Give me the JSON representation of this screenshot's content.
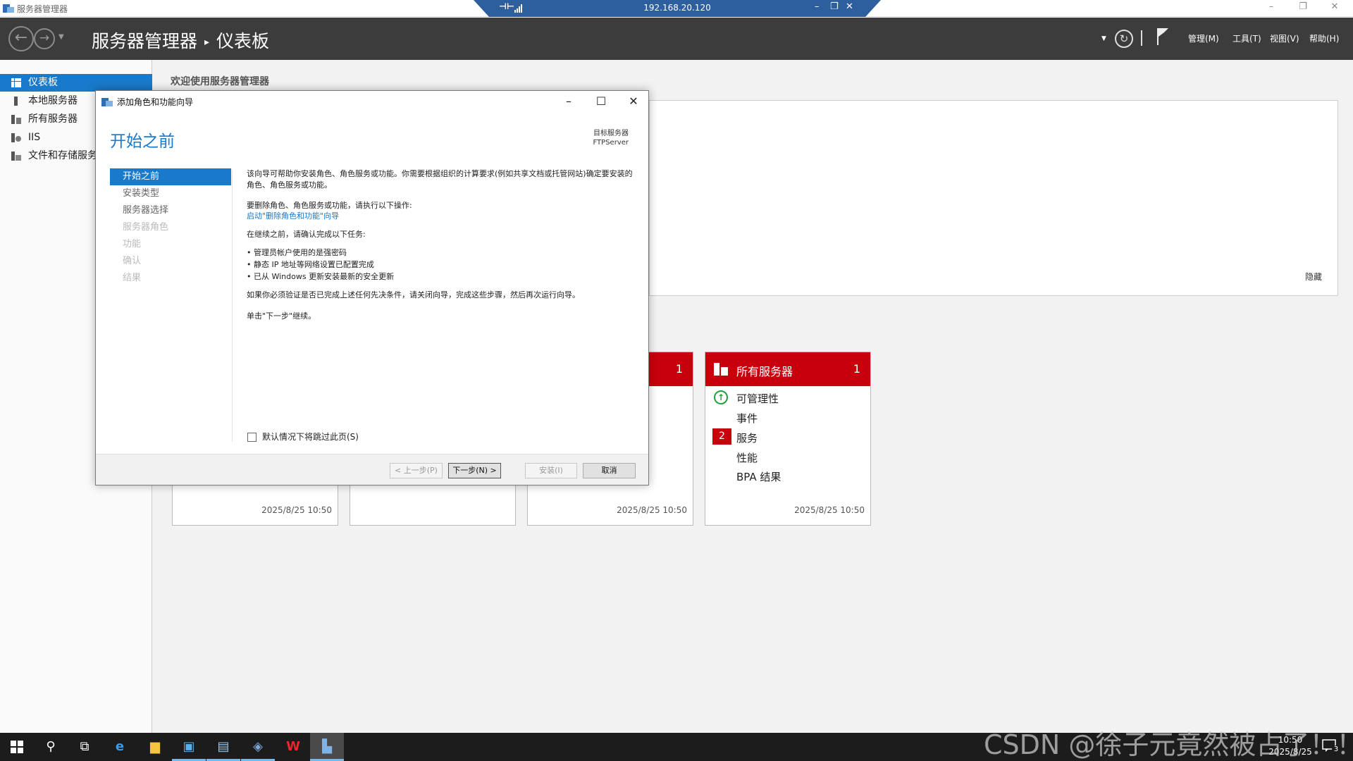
{
  "window": {
    "app_title": "服务器管理器",
    "rdp_ip": "192.168.20.120",
    "controls": {
      "minimize": "–",
      "restore": "❐",
      "close": "✕"
    }
  },
  "header": {
    "breadcrumb_app": "服务器管理器",
    "breadcrumb_sep": "▸",
    "breadcrumb_page": "仪表板",
    "menus": [
      "管理(M)",
      "工具(T)",
      "视图(V)",
      "帮助(H)"
    ]
  },
  "sidebar": {
    "items": [
      {
        "label": "仪表板",
        "icon": "dashboard-icon",
        "active": true
      },
      {
        "label": "本地服务器",
        "icon": "server-icon"
      },
      {
        "label": "所有服务器",
        "icon": "servers-icon"
      },
      {
        "label": "IIS",
        "icon": "iis-icon"
      },
      {
        "label": "文件和存储服务",
        "icon": "storage-icon"
      }
    ]
  },
  "main": {
    "welcome_title": "欢迎使用服务器管理器",
    "hide_label": "隐藏"
  },
  "tiles": [
    {
      "timestamp": "2025/8/25 10:50"
    },
    {
      "timestamp": ""
    },
    {
      "count": "1",
      "timestamp": "2025/8/25 10:50"
    },
    {
      "name": "所有服务器",
      "count": "1",
      "rows": [
        "可管理性",
        "事件",
        "服务",
        "性能",
        "BPA 结果"
      ],
      "services_badge": "2",
      "timestamp": "2025/8/25 10:50"
    }
  ],
  "wizard": {
    "title": "添加角色和功能向导",
    "heading": "开始之前",
    "target_label": "目标服务器",
    "target_server": "FTPServer",
    "steps": [
      {
        "label": "开始之前",
        "state": "active"
      },
      {
        "label": "安装类型",
        "state": "normal"
      },
      {
        "label": "服务器选择",
        "state": "normal"
      },
      {
        "label": "服务器角色",
        "state": "disabled"
      },
      {
        "label": "功能",
        "state": "disabled"
      },
      {
        "label": "确认",
        "state": "disabled"
      },
      {
        "label": "结果",
        "state": "disabled"
      }
    ],
    "intro": "该向导可帮助你安装角色、角色服务或功能。你需要根据组织的计算要求(例如共享文档或托管网站)确定要安装的角色、角色服务或功能。",
    "remove_intro": "要删除角色、角色服务或功能，请执行以下操作:",
    "remove_link": "启动\"删除角色和功能\"向导",
    "before_continue": "在继续之前，请确认完成以下任务:",
    "tasks": [
      "• 管理员帐户使用的是强密码",
      "• 静态 IP 地址等网络设置已配置完成",
      "• 已从 Windows 更新安装最新的安全更新"
    ],
    "prereq_note": "如果你必须验证是否已完成上述任何先决条件，请关闭向导，完成这些步骤，然后再次运行向导。",
    "click_next": "单击\"下一步\"继续。",
    "skip_checkbox": "默认情况下将跳过此页(S)",
    "buttons": {
      "prev": "< 上一步(P)",
      "next": "下一步(N) >",
      "install": "安装(I)",
      "cancel": "取消"
    }
  },
  "taskbar": {
    "time": "10:50",
    "date": "2025/8/25",
    "notifications": "3",
    "apps": [
      "start-icon",
      "search-icon",
      "task-view-icon",
      "ie-icon",
      "explorer-icon",
      "cmd-icon",
      "tool-icon",
      "remote-icon",
      "wps-icon",
      "server-manager-icon"
    ]
  },
  "watermark": "CSDN @徐子元竟然被占了！！"
}
